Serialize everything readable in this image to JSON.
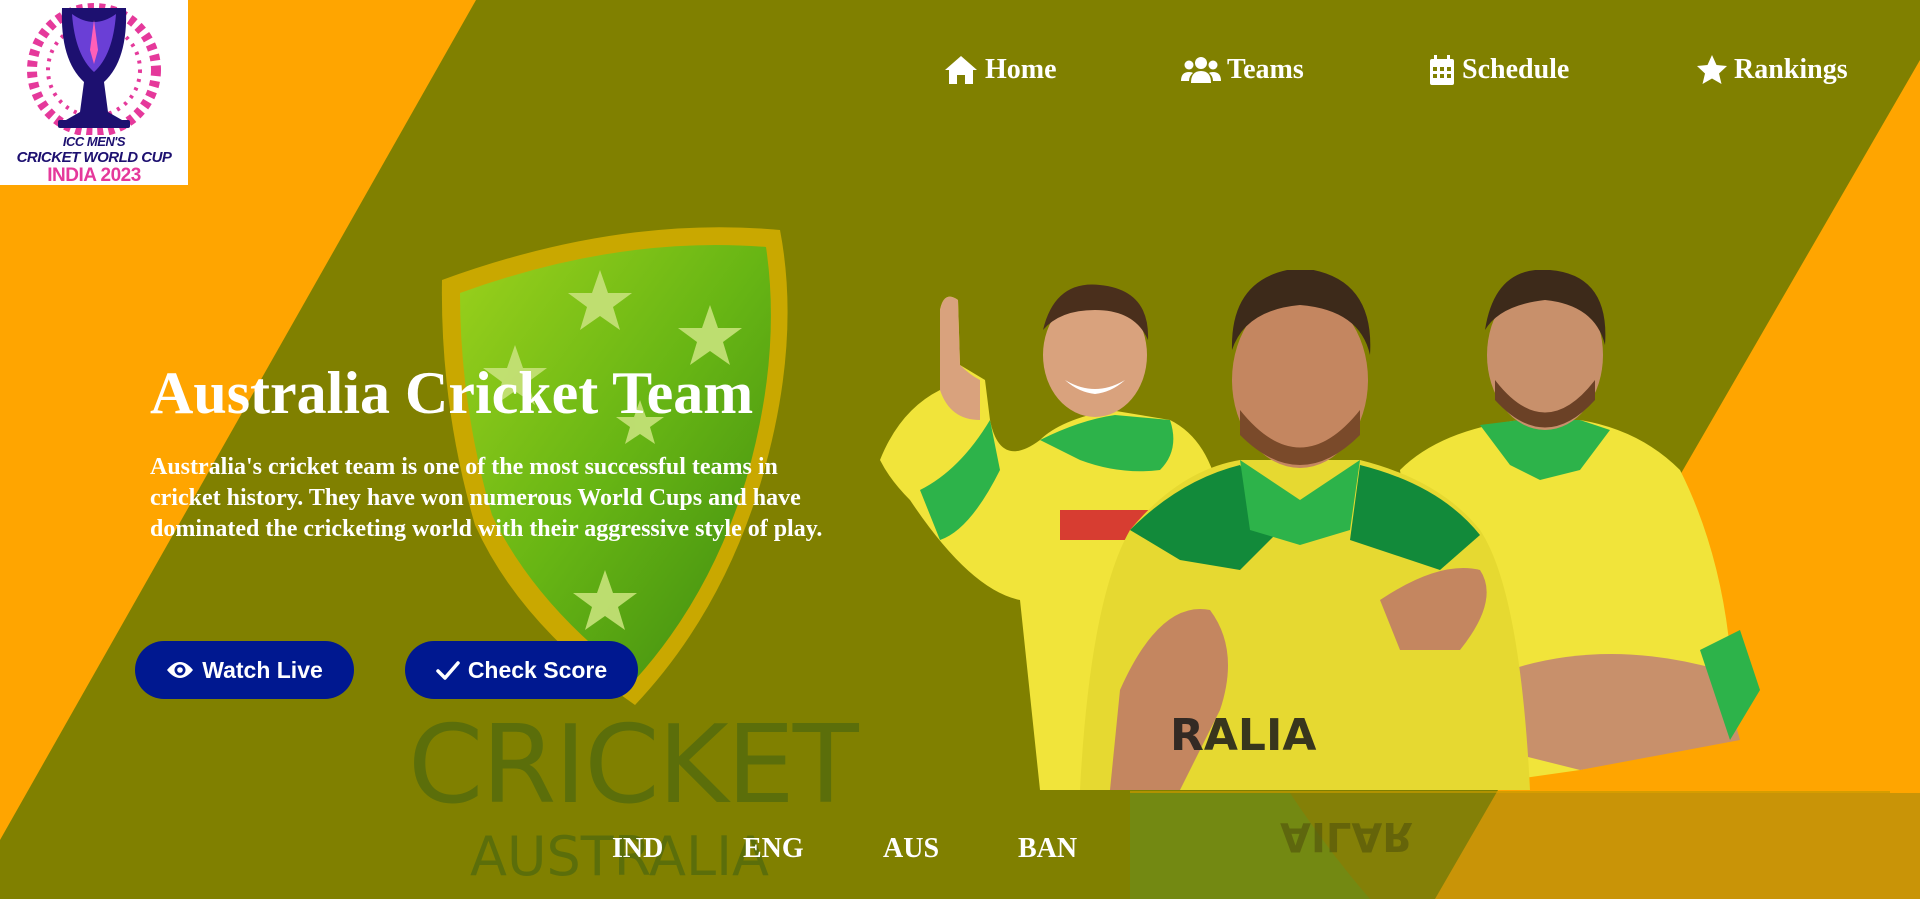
{
  "logo": {
    "line1": "ICC MEN'S",
    "line2": "CRICKET WORLD CUP",
    "line3": "INDIA 2023"
  },
  "nav": {
    "items": [
      {
        "label": "Home",
        "icon": "home-icon"
      },
      {
        "label": "Teams",
        "icon": "users-icon"
      },
      {
        "label": "Schedule",
        "icon": "calendar-icon"
      },
      {
        "label": "Rankings",
        "icon": "star-icon"
      }
    ]
  },
  "hero": {
    "title": "Australia Cricket Team",
    "description": "Australia's cricket team is one of the most successful teams in cricket history. They have won numerous World Cups and have dominated the cricketing world with their aggressive style of play.",
    "watch_button": "Watch Live",
    "score_button": "Check Score",
    "watermark_main": "CRICKET",
    "watermark_sub": "AUSTRALIA"
  },
  "teams": [
    "IND",
    "ENG",
    "AUS",
    "BAN"
  ],
  "colors": {
    "background_orange": "#ffa500",
    "band_olive": "#808000",
    "button_navy": "#001890",
    "text_white": "#ffffff"
  }
}
